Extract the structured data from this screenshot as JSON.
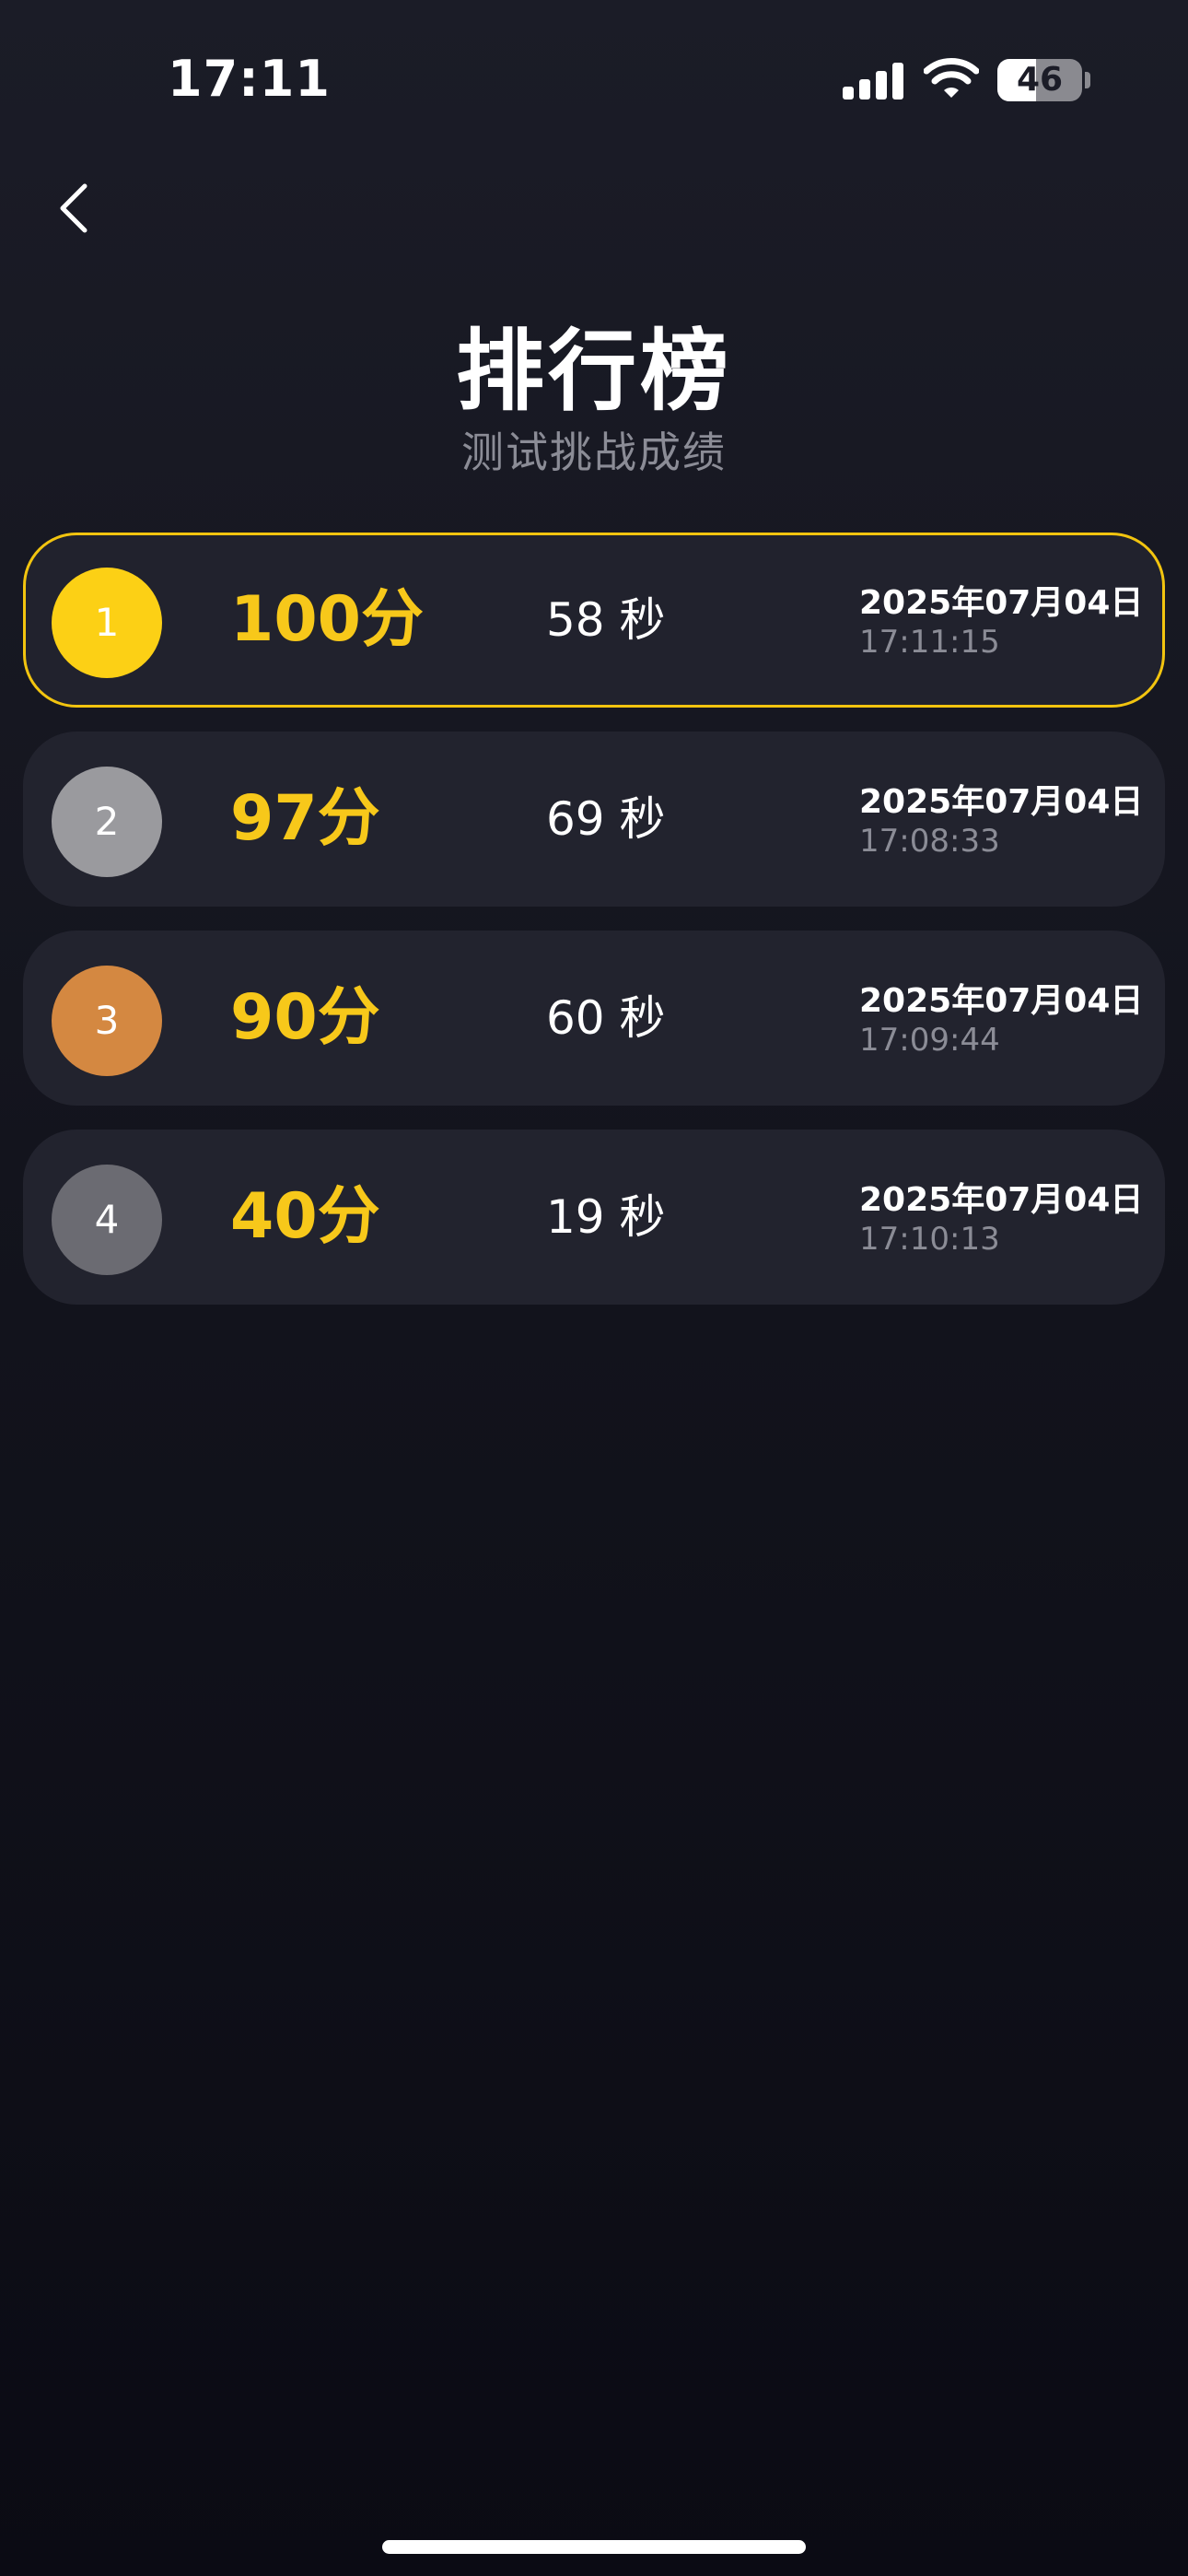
{
  "status_bar": {
    "time": "17:11",
    "battery_level": "46",
    "battery_fraction": 0.46,
    "signal_bars": 4
  },
  "header": {
    "back_icon": "chevron-left-icon",
    "title": "排行榜",
    "subtitle": "测试挑战成绩"
  },
  "colors": {
    "accent": "#f7c81a",
    "gold": "#fcd015",
    "silver": "#9a9a9e",
    "bronze": "#d48841",
    "default_badge": "#6b6b72",
    "card_bg": "#22232e",
    "highlight_border": "#f2c40f"
  },
  "rankings": [
    {
      "rank": "1",
      "score": "100分",
      "duration": "58 秒",
      "date": "2025年07月04日",
      "time": "17:11:15",
      "badge_color": "#fcd015"
    },
    {
      "rank": "2",
      "score": "97分",
      "duration": "69 秒",
      "date": "2025年07月04日",
      "time": "17:08:33",
      "badge_color": "#9a9a9e"
    },
    {
      "rank": "3",
      "score": "90分",
      "duration": "60 秒",
      "date": "2025年07月04日",
      "time": "17:09:44",
      "badge_color": "#d48841"
    },
    {
      "rank": "4",
      "score": "40分",
      "duration": "19 秒",
      "date": "2025年07月04日",
      "time": "17:10:13",
      "badge_color": "#6b6b72"
    }
  ]
}
